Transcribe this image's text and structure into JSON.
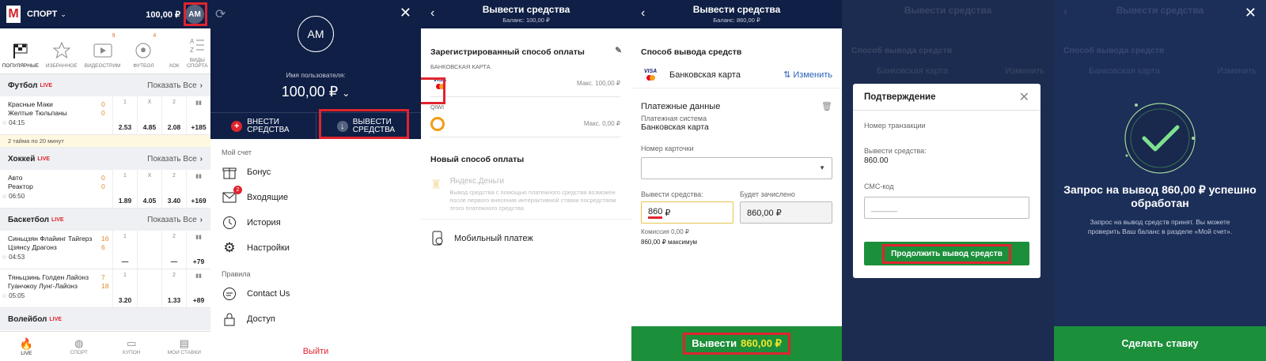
{
  "colors": {
    "navy": "#0f1f45",
    "green": "#1c8f3b",
    "red": "#e0242e",
    "link": "#2a62b8",
    "accent_yellow": "#f5e72a"
  },
  "p1": {
    "sport": "СПОРТ",
    "balance": "100,00 ₽",
    "avatar": "AM",
    "cats": [
      "ПОПУЛЯРНЫЕ",
      "ИЗБРАННОЕ",
      "ВИДЕОСТРИМ",
      "ФУТБОЛ",
      "ХОК",
      "ВИДЫ СПОРТА"
    ],
    "badge_video": "9",
    "badge_foot": "4",
    "sections": [
      {
        "title": "Футбол",
        "live": "LIVE",
        "all": "Показать Все",
        "rows": [
          {
            "t1": "Красные Маки",
            "t2": "Желтые Тюльпаны",
            "time": "04:15",
            "s1": "0",
            "s2": "0",
            "h": [
              "1",
              "X",
              "2"
            ],
            "o": [
              "2.53",
              "4.85",
              "2.08"
            ],
            "more": "+185"
          }
        ]
      },
      {
        "title": "Хоккей",
        "live": "LIVE",
        "all": "Показать Все",
        "rows": [
          {
            "t1": "Авто",
            "t2": "Реактор",
            "time": "06:50",
            "s1": "0",
            "s2": "0",
            "h": [
              "1",
              "X",
              "2"
            ],
            "o": [
              "1.89",
              "4.05",
              "3.40"
            ],
            "more": "+169"
          }
        ]
      },
      {
        "title": "Баскетбол",
        "live": "LIVE",
        "all": "Показать Все",
        "rows": [
          {
            "t1": "Синьцзян Флайинг Тайгерз",
            "t2": "Цзянсу Драгонз",
            "time": "04:53",
            "s1": "16",
            "s2": "6",
            "h": [
              "1",
              "",
              "2"
            ],
            "o": [
              "—",
              "",
              "—"
            ],
            "more": "+79"
          },
          {
            "t1": "Тяньцзинь Голден Лайонз",
            "t2": "Гуанчжоу Лунг-Лайонз",
            "time": "05:05",
            "s1": "7",
            "s2": "18",
            "h": [
              "1",
              "",
              "2"
            ],
            "o": [
              "3.20",
              "",
              "1.33"
            ],
            "more": "+89"
          }
        ]
      },
      {
        "title": "Волейбол",
        "live": "LIVE",
        "all": "",
        "rows": []
      }
    ],
    "note": "2 тайма по 20 минут",
    "bottom": [
      "LIVE",
      "СПОРТ",
      "КУПОН",
      "МОИ СТАВКИ"
    ]
  },
  "p2": {
    "avatar": "AM",
    "user_label": "Имя пользователя:",
    "balance": "100,00 ₽",
    "deposit": "ВНЕСТИ СРЕДСТВА",
    "withdraw": "ВЫВЕСТИ СРЕДСТВА",
    "acc_header": "Мой счет",
    "items": [
      "Бонус",
      "Входящие",
      "История",
      "Настройки"
    ],
    "inbox_badge": "2",
    "rules_header": "Правила",
    "items2": [
      "Contact Us",
      "Доступ"
    ],
    "exit": "Выйти"
  },
  "p3": {
    "title": "Вывести средства",
    "subtitle": "Баланс: 100,00 ₽",
    "reg": "Зарегистрированный способ оплаты",
    "card_label": "БАНКОВСКАЯ КАРТА",
    "card_max": "Макс. 100,00 ₽",
    "qiwi_label": "QIWI",
    "qiwi_max": "Макс. 0,00 ₽",
    "new_title": "Новый способ оплаты",
    "yandex": "Яндекс.Деньги",
    "yandex_desc": "Вывод средства с помощью платежного средства возможен после первого внесения интерактивной ставки посредством этого платежного средства",
    "mobile": "Мобильный платеж"
  },
  "p4": {
    "title": "Вывести средства",
    "subtitle": "Баланс: 860,00 ₽",
    "method_title": "Способ вывода средств",
    "card": "Банковская карта",
    "change": "Изменить",
    "pay_title": "Платежные данные",
    "system_label": "Платежная система",
    "system": "Банковская карта",
    "card_num": "Номер карточки",
    "wd_label": "Вывести средства:",
    "wd_value": "860",
    "wd_cur": "₽",
    "cred_label": "Будет зачислено",
    "cred_value": "860,00 ₽",
    "fee": "Комиссия 0,00 ₽",
    "max": "860,00 ₽ максимум",
    "btn": "Вывести",
    "btn_amount": "860,00 ₽"
  },
  "p5": {
    "title": "Подтверждение",
    "txn": "Номер транзакции",
    "wd_label": "Вывести средства:",
    "wd_value": "860.00",
    "sms": "СМС-код",
    "sms_ph": "______",
    "btn": "Продолжить вывод средств",
    "bg_title": "Вывести средства",
    "bg_method": "Способ вывода средств",
    "bg_card": "Банковская карта",
    "bg_change": "Изменить"
  },
  "p6": {
    "bg_title": "Вывести средства",
    "bg_method": "Способ вывода средств",
    "bg_card": "Банковская карта",
    "bg_change": "Изменить",
    "ok_title": "Запрос на вывод 860,00 ₽ успешно обработан",
    "ok_desc": "Запрос на вывод средств принят. Вы можете проверить Ваш баланс в разделе «Мой счет».",
    "btn": "Сделать ставку"
  }
}
